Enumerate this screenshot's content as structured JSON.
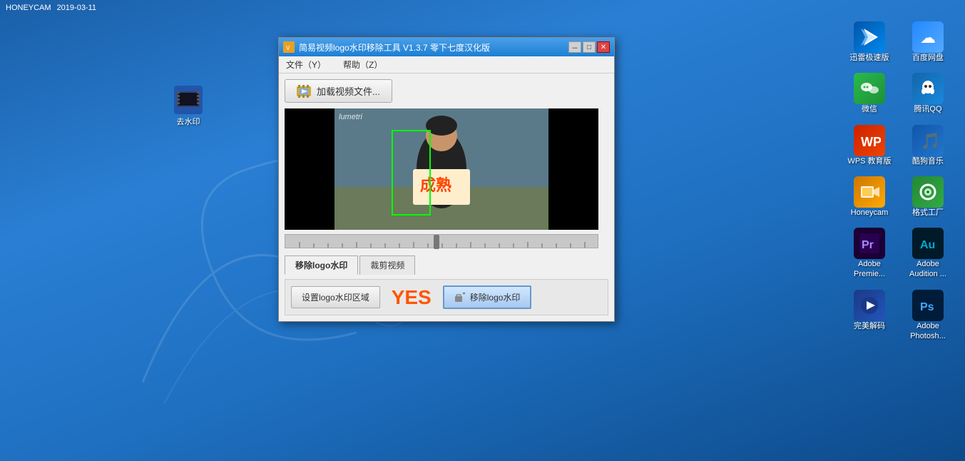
{
  "topbar": {
    "app": "HONEYCAM",
    "datetime": "2019-03-11"
  },
  "desktop": {
    "icons": [
      {
        "id": "qu-shuiyin",
        "label": "去水印",
        "color": "#4488cc",
        "symbol": "🎬"
      }
    ]
  },
  "sidebar_right": {
    "icons": [
      {
        "id": "xunlei",
        "label": "迅雷极速版",
        "color": "#1a90d0",
        "symbol": "⚡",
        "bg": "#0066bb"
      },
      {
        "id": "baidu-cloud",
        "label": "百度网盘",
        "color": "#fff",
        "symbol": "☁",
        "bg": "#3399ff"
      },
      {
        "id": "wechat",
        "label": "微信",
        "color": "#fff",
        "symbol": "💬",
        "bg": "#2dc84d"
      },
      {
        "id": "tencent-qq",
        "label": "腾讯QQ",
        "color": "#fff",
        "symbol": "🐧",
        "bg": "#1a8fd1"
      },
      {
        "id": "wps",
        "label": "WPS 教育版",
        "color": "#fff",
        "symbol": "W",
        "bg": "#cc2200"
      },
      {
        "id": "kugou",
        "label": "酷狗音乐",
        "color": "#fff",
        "symbol": "♪",
        "bg": "#1a6faa"
      },
      {
        "id": "honeycam",
        "label": "Honeycam",
        "color": "#fff",
        "symbol": "📹",
        "bg": "#e08000"
      },
      {
        "id": "geshi-gongchang",
        "label": "格式工厂",
        "color": "#fff",
        "symbol": "⚙",
        "bg": "#228833"
      },
      {
        "id": "adobe-premiere",
        "label": "Adobe Premie...",
        "color": "#fff",
        "symbol": "Pr",
        "bg": "#2a0050"
      },
      {
        "id": "adobe-audition",
        "label": "Adobe Audition ...",
        "color": "#fff",
        "symbol": "Au",
        "bg": "#001a2a"
      },
      {
        "id": "wanmei-jiema",
        "label": "完美解码",
        "color": "#fff",
        "symbol": "▶",
        "bg": "#1a4488"
      },
      {
        "id": "adobe-photoshop",
        "label": "Adobe Photosh...",
        "color": "#fff",
        "symbol": "Ps",
        "bg": "#001c3a"
      }
    ]
  },
  "window": {
    "title": "简易视频logo水印移除工具 V1.3.7 零下七度汉化版",
    "menu": {
      "file": "文件（Y）",
      "help": "帮助（Z）"
    },
    "load_button": "加载视频文件...",
    "tabs": [
      {
        "id": "remove-logo",
        "label": "移除logo水印",
        "active": true
      },
      {
        "id": "crop-video",
        "label": "裁剪视频",
        "active": false
      }
    ],
    "action_area": {
      "set_region_btn": "设置logo水印区域",
      "yes_label": "YES",
      "remove_btn": "移除logo水印"
    },
    "video": {
      "watermark_text": "lumetri"
    }
  }
}
